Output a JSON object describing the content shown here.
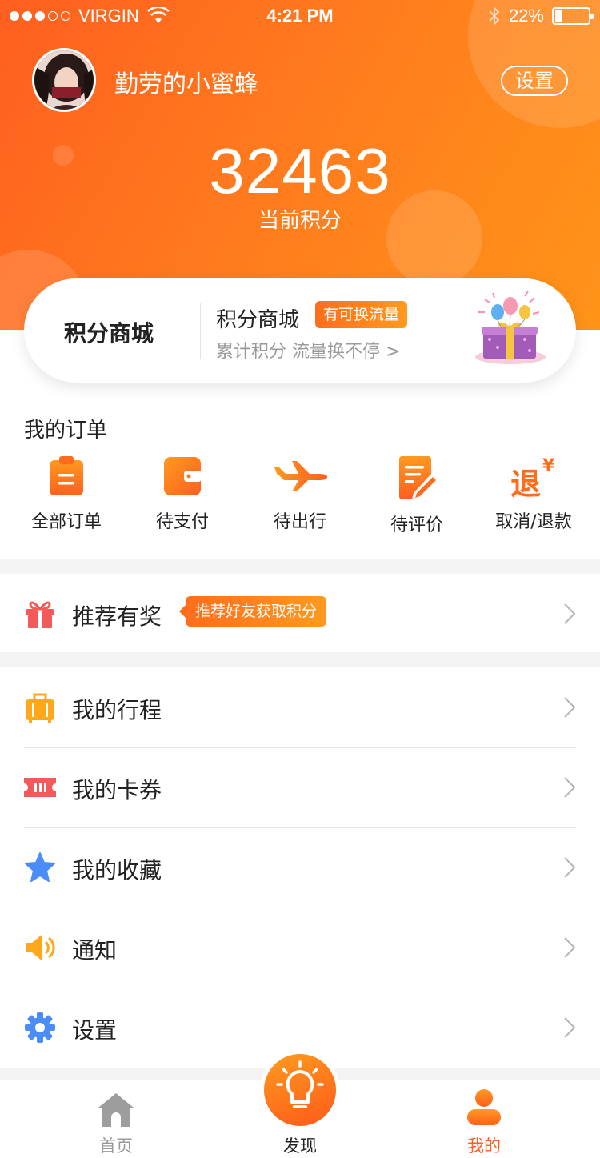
{
  "status_bar": {
    "carrier": "VIRGIN",
    "time": "4:21 PM",
    "battery": "22%"
  },
  "profile": {
    "username": "勤劳的小蜜蜂",
    "settings_label": "设置"
  },
  "points": {
    "value": "32463",
    "label": "当前积分"
  },
  "mall_card": {
    "left_title": "积分商城",
    "title": "积分商城",
    "tag": "有可换流量",
    "subtitle": "累计积分 流量换不停 >"
  },
  "orders": {
    "title": "我的订单",
    "items": [
      {
        "label": "全部订单",
        "icon": "clipboard-icon"
      },
      {
        "label": "待支付",
        "icon": "wallet-icon"
      },
      {
        "label": "待出行",
        "icon": "airplane-icon"
      },
      {
        "label": "待评价",
        "icon": "review-icon"
      },
      {
        "label": "取消/退款",
        "icon": "refund-icon",
        "glyph": "退",
        "currency": "¥"
      }
    ]
  },
  "reward": {
    "label": "推荐有奖",
    "tag": "推荐好友获取积分",
    "icon": "gift-icon"
  },
  "menu": [
    {
      "label": "我的行程",
      "icon": "luggage-icon"
    },
    {
      "label": "我的卡券",
      "icon": "ticket-icon"
    },
    {
      "label": "我的收藏",
      "icon": "star-icon"
    },
    {
      "label": "通知",
      "icon": "speaker-icon"
    },
    {
      "label": "设置",
      "icon": "gear-icon"
    }
  ],
  "tabbar": {
    "items": [
      {
        "label": "首页",
        "icon": "home-icon",
        "active": false
      },
      {
        "label": "发现",
        "icon": "lightbulb-icon",
        "active": false
      },
      {
        "label": "我的",
        "icon": "user-icon",
        "active": true
      }
    ]
  },
  "colors": {
    "accent": "#ff6d1c",
    "accent_light": "#ff9a1f",
    "active_tab": "#ff5f1f",
    "inactive_tab": "#999999",
    "star_blue": "#4a8df6",
    "ticket_red": "#f55a5a",
    "luggage_yellow": "#ffa81a"
  }
}
